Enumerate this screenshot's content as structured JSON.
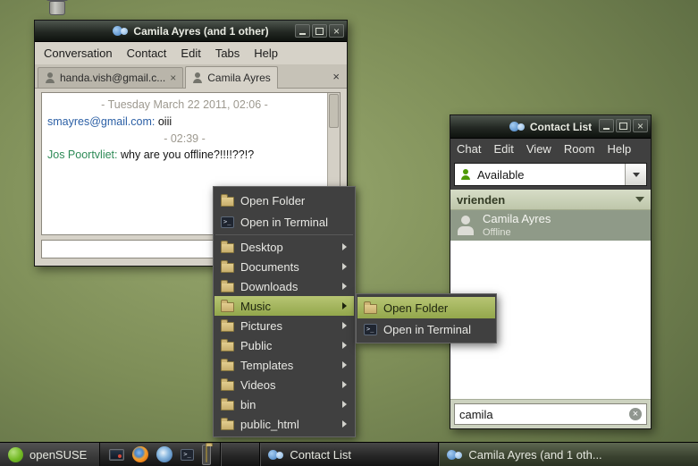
{
  "chat_window": {
    "title": "Camila Ayres (and 1 other)",
    "menu": {
      "items": [
        "Conversation",
        "Contact",
        "Edit",
        "Tabs",
        "Help"
      ]
    },
    "tabs": [
      {
        "label": "handa.vish@gmail.c..."
      },
      {
        "label": "Camila Ayres"
      }
    ],
    "lines": [
      {
        "kind": "time",
        "text": "- Tuesday March 22 2011, 02:06 -"
      },
      {
        "kind": "msg",
        "sender": "smayres@gmail.com:",
        "text": "oiii"
      },
      {
        "kind": "time",
        "text": "- 02:39 -"
      },
      {
        "kind": "msg",
        "sender": "Jos Poortvliet:",
        "text": "why are you offline?!!!!??!?"
      }
    ],
    "input_value": ""
  },
  "context_menu": {
    "actions": [
      {
        "label": "Open Folder"
      },
      {
        "label": "Open in Terminal"
      }
    ],
    "folders": [
      {
        "label": "Desktop"
      },
      {
        "label": "Documents"
      },
      {
        "label": "Downloads"
      },
      {
        "label": "Music",
        "highlighted": true
      },
      {
        "label": "Pictures"
      },
      {
        "label": "Public"
      },
      {
        "label": "Templates"
      },
      {
        "label": "Videos"
      },
      {
        "label": "bin"
      },
      {
        "label": "public_html"
      }
    ],
    "submenu": {
      "items": [
        {
          "label": "Open Folder",
          "highlighted": true
        },
        {
          "label": "Open in Terminal"
        }
      ]
    }
  },
  "contact_list": {
    "title": "Contact List",
    "menu": {
      "items": [
        "Chat",
        "Edit",
        "View",
        "Room",
        "Help"
      ]
    },
    "status_selector": {
      "value": "Available"
    },
    "group": {
      "label": "vrienden"
    },
    "contacts": [
      {
        "name": "Camila Ayres",
        "status": "Offline"
      }
    ],
    "search": {
      "value": "camila"
    }
  },
  "taskbar": {
    "start": {
      "label": "openSUSE"
    },
    "tasks": [
      {
        "label": "Contact List"
      },
      {
        "label": "Camila Ayres (and 1 oth...",
        "active": true
      }
    ]
  },
  "colors": {
    "menu_highlight_green": "#9fb45e",
    "sender_blue": "#2b5fa5",
    "sender_green": "#2e8b57",
    "desktop_green": "#7e8e58",
    "selected_contact_bg": "#8f9a88"
  }
}
